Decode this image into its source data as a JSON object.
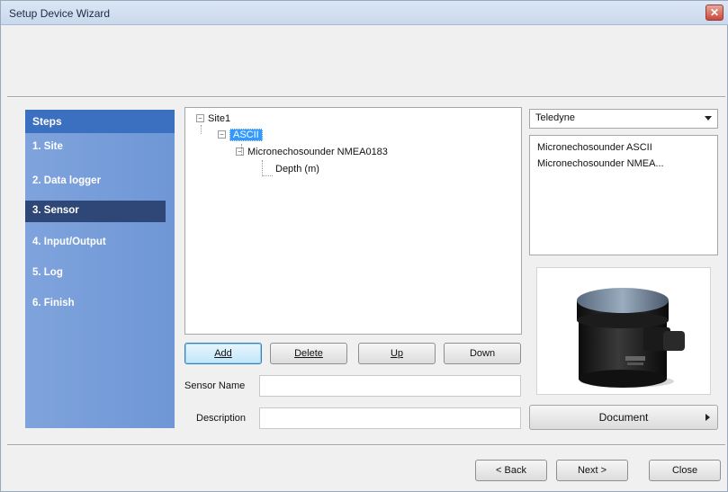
{
  "window": {
    "title": "Setup Device Wizard",
    "close_glyph": "✕"
  },
  "steps": {
    "header": "Steps",
    "items": [
      {
        "label": "1. Site"
      },
      {
        "label": "2. Data logger"
      },
      {
        "label": "3. Sensor",
        "active": true
      },
      {
        "label": "4. Input/Output"
      },
      {
        "label": "5. Log"
      },
      {
        "label": "6. Finish"
      }
    ]
  },
  "tree": {
    "root": "Site1",
    "child": "ASCII",
    "sensor": "Micronechosounder NMEA0183",
    "channel": "Depth (m)"
  },
  "buttons": {
    "add": "Add",
    "delete": "Delete",
    "up": "Up",
    "down": "Down"
  },
  "form": {
    "sensor_name_label": "Sensor Name",
    "sensor_name_value": "",
    "description_label": "Description",
    "description_value": ""
  },
  "manufacturer": {
    "selected": "Teledyne"
  },
  "sensor_list": [
    "Micronechosounder ASCII",
    "Micronechosounder NMEA..."
  ],
  "document_button": "Document",
  "footer": {
    "back": "< Back",
    "next": "Next >",
    "close": "Close"
  },
  "colors": {
    "steps_bg": "#7fa3dc",
    "steps_header": "#3b6fc0",
    "active_step": "#2f4777",
    "selection": "#3399ff"
  }
}
